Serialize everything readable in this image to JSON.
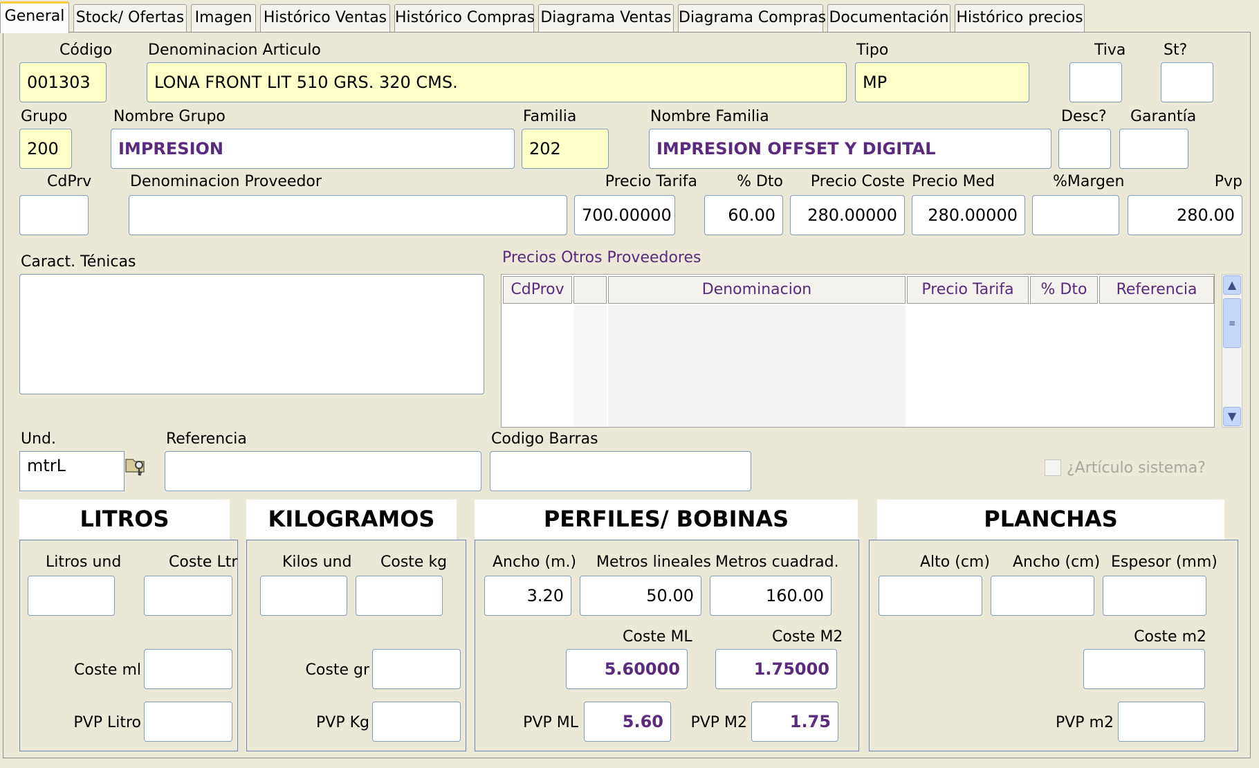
{
  "tabs": [
    "General",
    "Stock/ Ofertas",
    "Imagen",
    "Histórico Ventas",
    "Histórico Compras",
    "Diagrama Ventas",
    "Diagrama Compras",
    "Documentación",
    "Histórico precios"
  ],
  "fields": {
    "codigo": {
      "label": "Código",
      "value": "001303"
    },
    "denominacion": {
      "label": "Denominacion Articulo",
      "value": "LONA FRONT LIT 510 GRS. 320 CMS."
    },
    "tipo": {
      "label": "Tipo",
      "value": "MP"
    },
    "tiva": {
      "label": "Tiva",
      "value": ""
    },
    "st": {
      "label": "St?",
      "value": ""
    },
    "grupo": {
      "label": "Grupo",
      "value": "200"
    },
    "nombre_grupo": {
      "label": "Nombre Grupo",
      "value": "IMPRESION"
    },
    "familia": {
      "label": "Familia",
      "value": "202"
    },
    "nombre_familia": {
      "label": "Nombre Familia",
      "value": "IMPRESION OFFSET Y DIGITAL"
    },
    "desc": {
      "label": "Desc?",
      "value": ""
    },
    "garantia": {
      "label": "Garantía",
      "value": ""
    },
    "cdprv": {
      "label": "CdPrv",
      "value": ""
    },
    "denominacion_proveedor": {
      "label": "Denominacion Proveedor",
      "value": ""
    },
    "precio_tarifa": {
      "label": "Precio Tarifa",
      "value": "700.00000"
    },
    "dto": {
      "label": "% Dto",
      "value": "60.00"
    },
    "precio_coste": {
      "label": "Precio Coste",
      "value": "280.00000"
    },
    "precio_med": {
      "label": "Precio Med",
      "value": "280.00000"
    },
    "margen": {
      "label": "%Margen",
      "value": ""
    },
    "pvp": {
      "label": "Pvp",
      "value": "280.00"
    },
    "caract": {
      "label": "Caract. Ténicas",
      "value": ""
    },
    "und": {
      "label": "Und.",
      "value": "mtrL"
    },
    "referencia": {
      "label": "Referencia",
      "value": ""
    },
    "codigo_barras": {
      "label": "Codigo Barras",
      "value": ""
    },
    "articulo_sistema": {
      "label": "¿Artículo sistema?"
    }
  },
  "otros_proveedores": {
    "title": "Precios Otros Proveedores",
    "columns": [
      "CdProv",
      "",
      "Denominacion",
      "Precio Tarifa",
      "% Dto",
      "Referencia"
    ]
  },
  "sections": {
    "litros": {
      "title": "LITROS",
      "litros_und": {
        "label": "Litros und",
        "value": ""
      },
      "coste_ltr": {
        "label": "Coste Ltr",
        "value": ""
      },
      "coste_ml": {
        "label": "Coste ml",
        "value": ""
      },
      "pvp_litro": {
        "label": "PVP Litro",
        "value": ""
      }
    },
    "kilogramos": {
      "title": "KILOGRAMOS",
      "kilos_und": {
        "label": "Kilos und",
        "value": ""
      },
      "coste_kg": {
        "label": "Coste kg",
        "value": ""
      },
      "coste_gr": {
        "label": "Coste gr",
        "value": ""
      },
      "pvp_kg": {
        "label": "PVP Kg",
        "value": ""
      }
    },
    "perfiles": {
      "title": "PERFILES/ BOBINAS",
      "ancho": {
        "label": "Ancho (m.)",
        "value": "3.20"
      },
      "metros_lineales": {
        "label": "Metros lineales",
        "value": "50.00"
      },
      "metros_cuadrados": {
        "label": "Metros cuadrad.",
        "value": "160.00"
      },
      "coste_ml": {
        "label": "Coste ML",
        "value": "5.60000"
      },
      "coste_m2": {
        "label": "Coste M2",
        "value": "1.75000"
      },
      "pvp_ml": {
        "label": "PVP ML",
        "value": "5.60"
      },
      "pvp_m2": {
        "label": "PVP M2",
        "value": "1.75"
      }
    },
    "planchas": {
      "title": "PLANCHAS",
      "alto": {
        "label": "Alto (cm)",
        "value": ""
      },
      "ancho": {
        "label": "Ancho (cm)",
        "value": ""
      },
      "espesor": {
        "label": "Espesor (mm)",
        "value": ""
      },
      "coste_m2": {
        "label": "Coste m2",
        "value": ""
      },
      "pvp_m2": {
        "label": "PVP m2",
        "value": ""
      }
    }
  },
  "icons": {
    "unit_lookup": "key-folder-icon",
    "scroll_up": "chevron-up-icon",
    "scroll_down": "chevron-down-icon"
  }
}
